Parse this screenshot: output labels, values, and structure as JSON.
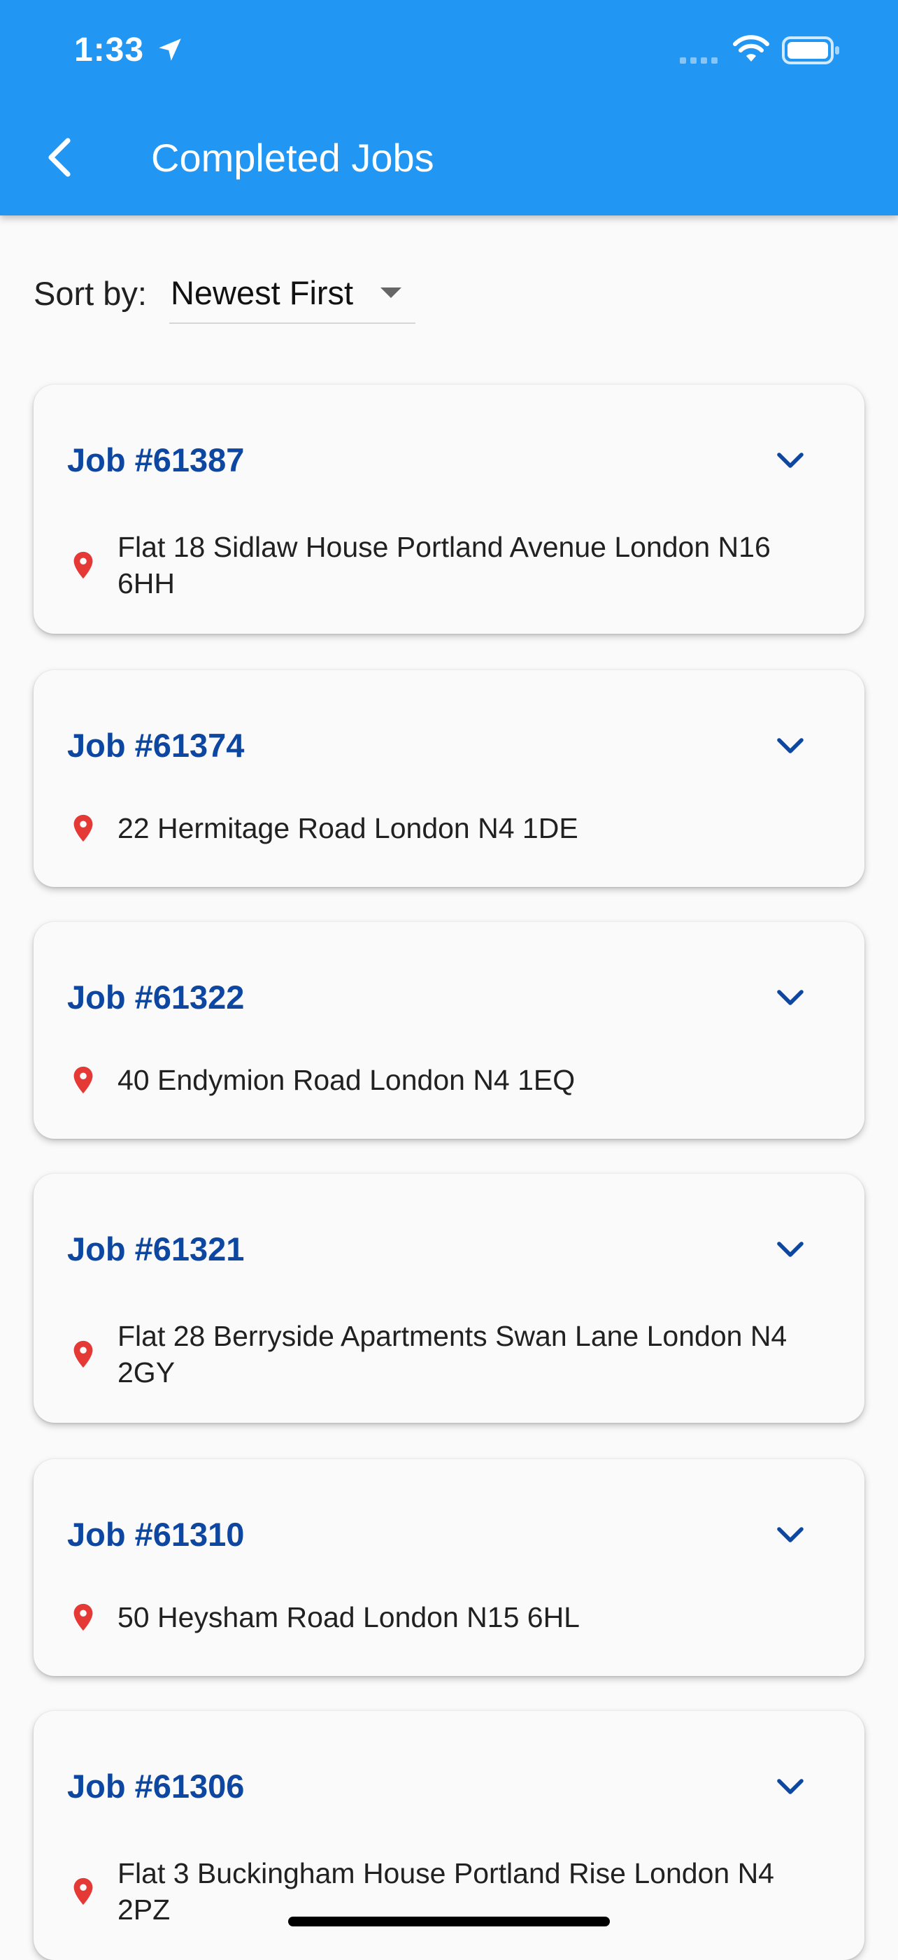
{
  "status_bar": {
    "time": "1:33"
  },
  "app_bar": {
    "title": "Completed Jobs",
    "color": "#2196f3"
  },
  "sort": {
    "label": "Sort by:",
    "selected": "Newest First"
  },
  "jobs": [
    {
      "title": "Job #61387",
      "address": "Flat 18 Sidlaw House Portland Avenue London N16 6HH"
    },
    {
      "title": "Job #61374",
      "address": "22 Hermitage Road London N4 1DE"
    },
    {
      "title": "Job #61322",
      "address": "40 Endymion Road London N4 1EQ"
    },
    {
      "title": "Job #61321",
      "address": "Flat 28 Berryside Apartments Swan Lane London N4 2GY"
    },
    {
      "title": "Job #61310",
      "address": "50 Heysham Road London N15 6HL"
    },
    {
      "title": "Job #61306",
      "address": "Flat 3 Buckingham House Portland Rise London N4 2PZ"
    }
  ],
  "colors": {
    "job_title": "#0d47a1",
    "pin": "#e53935",
    "background": "#fafafa"
  },
  "icons": {
    "back": "chevron-left-icon",
    "expand": "chevron-down-icon",
    "location": "location-pin-icon"
  }
}
